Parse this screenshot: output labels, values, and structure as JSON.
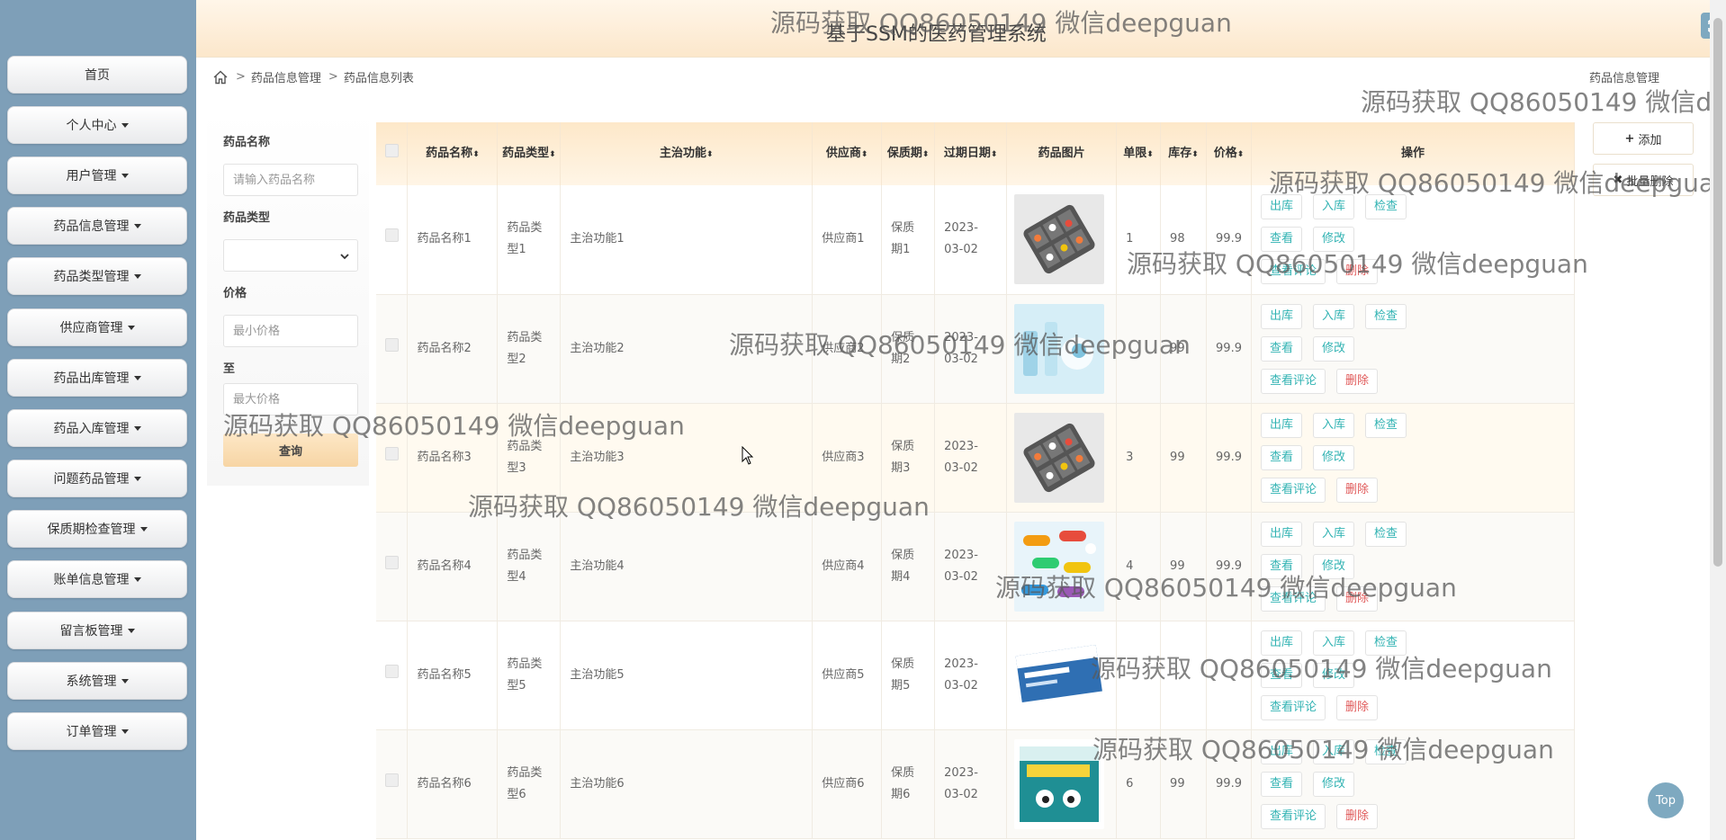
{
  "app": {
    "title": "基于SSM的医药管理系统"
  },
  "sidebar": {
    "items": [
      {
        "label": "首页",
        "dropdown": false
      },
      {
        "label": "个人中心",
        "dropdown": true
      },
      {
        "label": "用户管理",
        "dropdown": true
      },
      {
        "label": "药品信息管理",
        "dropdown": true
      },
      {
        "label": "药品类型管理",
        "dropdown": true
      },
      {
        "label": "供应商管理",
        "dropdown": true
      },
      {
        "label": "药品出库管理",
        "dropdown": true
      },
      {
        "label": "药品入库管理",
        "dropdown": true
      },
      {
        "label": "问题药品管理",
        "dropdown": true
      },
      {
        "label": "保质期检查管理",
        "dropdown": true
      },
      {
        "label": "账单信息管理",
        "dropdown": true
      },
      {
        "label": "留言板管理",
        "dropdown": true
      },
      {
        "label": "系统管理",
        "dropdown": true
      },
      {
        "label": "订单管理",
        "dropdown": true
      }
    ]
  },
  "breadcrumb": {
    "sep": ">",
    "items": [
      "药品信息管理",
      "药品信息列表"
    ]
  },
  "page_label": "药品信息管理",
  "search": {
    "name_label": "药品名称",
    "name_placeholder": "请输入药品名称",
    "type_label": "药品类型",
    "type_value": "",
    "price_label": "价格",
    "min_placeholder": "最小价格",
    "to_label": "至",
    "max_placeholder": "最大价格",
    "query_button": "查询"
  },
  "actions": {
    "add": "添加",
    "batch_delete": "批量删除"
  },
  "table": {
    "headers": [
      "药品名称",
      "药品类型",
      "主治功能",
      "供应商",
      "保质期",
      "过期日期",
      "药品图片",
      "单限",
      "库存",
      "价格",
      "操作"
    ],
    "op_labels": [
      "出库",
      "入库",
      "检查",
      "查看",
      "修改",
      "查看评论",
      "删除"
    ],
    "rows": [
      {
        "name": "药品名称1",
        "type": "药品类型1",
        "function": "主治功能1",
        "supplier": "供应商1",
        "shelf": "保质期1",
        "expire": "2023-03-02",
        "image": "pill-organizer",
        "limit": "1",
        "stock": "98",
        "price": "99.9"
      },
      {
        "name": "药品名称2",
        "type": "药品类型2",
        "function": "主治功能2",
        "supplier": "供应商2",
        "shelf": "保质期2",
        "expire": "2023-03-02",
        "image": "medicine-vials",
        "limit": "",
        "stock": "99",
        "price": "99.9"
      },
      {
        "name": "药品名称3",
        "type": "药品类型3",
        "function": "主治功能3",
        "supplier": "供应商3",
        "shelf": "保质期3",
        "expire": "2023-03-02",
        "image": "pill-organizer",
        "limit": "3",
        "stock": "99",
        "price": "99.9"
      },
      {
        "name": "药品名称4",
        "type": "药品类型4",
        "function": "主治功能4",
        "supplier": "供应商4",
        "shelf": "保质期4",
        "expire": "2023-03-02",
        "image": "colorful-capsules",
        "limit": "4",
        "stock": "99",
        "price": "99.9"
      },
      {
        "name": "药品名称5",
        "type": "药品类型5",
        "function": "主治功能5",
        "supplier": "供应商5",
        "shelf": "保质期5",
        "expire": "2023-03-02",
        "image": "medicine-box-blue",
        "limit": "",
        "stock": "",
        "price": ""
      },
      {
        "name": "药品名称6",
        "type": "药品类型6",
        "function": "主治功能6",
        "supplier": "供应商6",
        "shelf": "保质期6",
        "expire": "2023-03-02",
        "image": "medicine-box-teal",
        "limit": "6",
        "stock": "99",
        "price": "99.9"
      }
    ]
  },
  "watermark": "源码获取 QQ86050149 微信deepguan",
  "top_button": "Top",
  "colors": {
    "sidebar_bg": "#7e9fb8",
    "header_bg": "#fce7cb",
    "op_text": "#32b3b3",
    "delete_text": "#e05a5a"
  }
}
